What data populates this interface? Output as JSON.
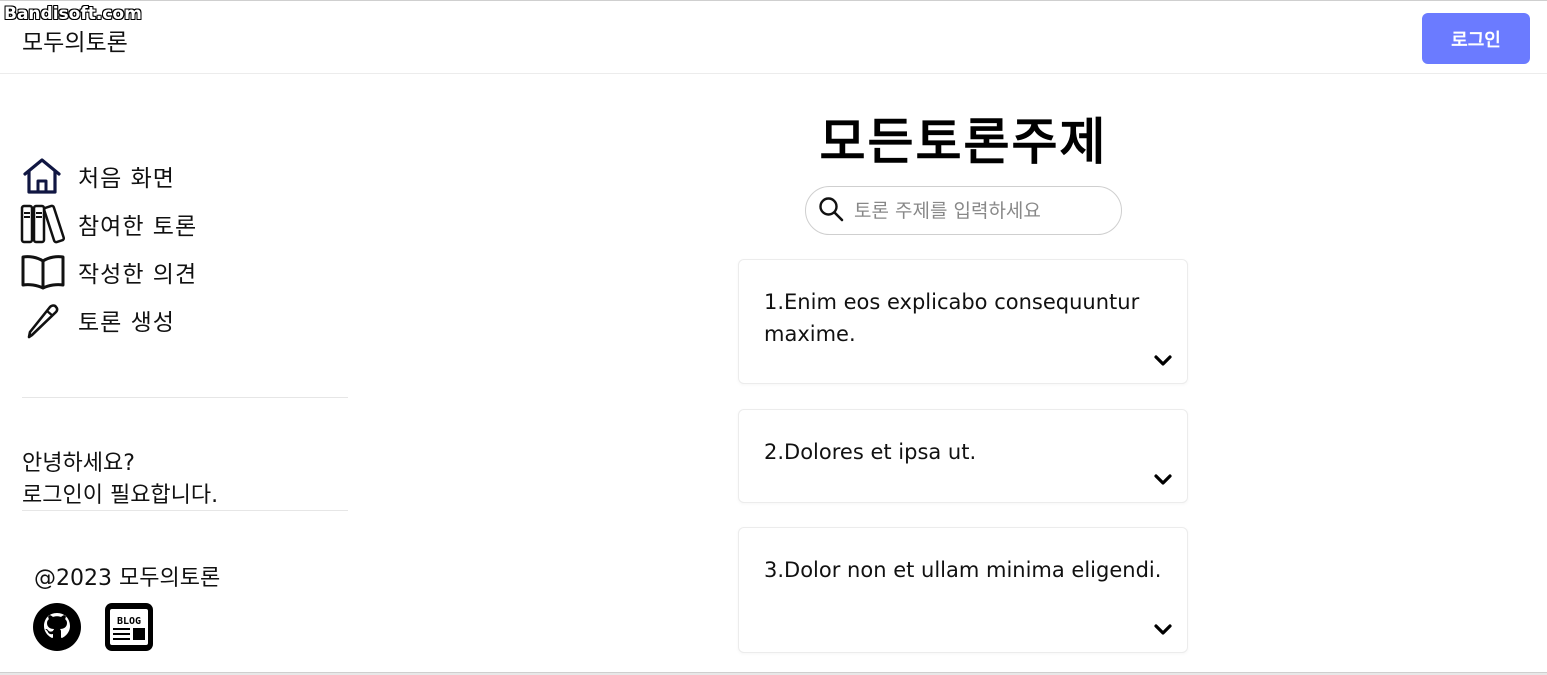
{
  "watermark": "Bandisoft.com",
  "header": {
    "logo": "모두의토론",
    "login_label": "로그인"
  },
  "sidebar": {
    "items": [
      {
        "label": "처음 화면",
        "icon": "home-icon"
      },
      {
        "label": "참여한 토론",
        "icon": "books-icon"
      },
      {
        "label": "작성한 의견",
        "icon": "open-book-icon"
      },
      {
        "label": "토론 생성",
        "icon": "pencil-icon"
      }
    ],
    "greeting_line1": "안녕하세요?",
    "greeting_line2": "로그인이 필요합니다.",
    "copyright": "@2023 모두의토론",
    "social": [
      {
        "icon": "github-icon"
      },
      {
        "icon": "blog-icon",
        "text": "BLOG"
      }
    ]
  },
  "main": {
    "title": "모든토론주제",
    "search_placeholder": "토론 주제를 입력하세요",
    "topics": [
      {
        "text": "1.Enim eos explicabo consequuntur maxime."
      },
      {
        "text": "2.Dolores et ipsa ut."
      },
      {
        "text": "3.Dolor non et ullam minima eligendi."
      }
    ]
  }
}
